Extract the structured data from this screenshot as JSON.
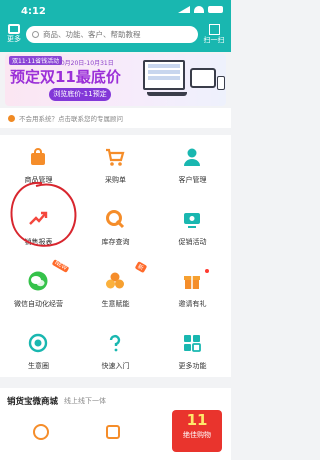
{
  "status_bar": {
    "time": "4:12"
  },
  "header": {
    "left_button": "更多",
    "search_placeholder": "商品、功能、客户、帮助教程",
    "scan_label": "扫一扫"
  },
  "banner": {
    "tag": "双11·11省钱活动",
    "date": "10月20日-10月31日",
    "headline": "预定双11最底价",
    "cta": "浏览底价-11预定"
  },
  "notice": {
    "text": "不会用系统？点击联系您的专属顾问"
  },
  "grid": [
    {
      "label": "商品管理",
      "icon": "bag-icon"
    },
    {
      "label": "采购单",
      "icon": "cart-icon"
    },
    {
      "label": "客户管理",
      "icon": "user-icon"
    },
    {
      "label": "销售报表",
      "icon": "trend-chart-icon"
    },
    {
      "label": "库存查询",
      "icon": "q-search-icon"
    },
    {
      "label": "促销活动",
      "icon": "promotion-icon"
    },
    {
      "label": "微信自动化经营",
      "icon": "wechat-icon",
      "badge": "NEW"
    },
    {
      "label": "生意赋能",
      "icon": "grow-icon",
      "badge": "新"
    },
    {
      "label": "邀请有礼",
      "icon": "gift-icon"
    },
    {
      "label": "生意圈",
      "icon": "circle-icon"
    },
    {
      "label": "快速入门",
      "icon": "question-icon"
    },
    {
      "label": "更多功能",
      "icon": "more-icon"
    }
  ],
  "mall": {
    "title": "销货宝微商城",
    "subtitle": "线上线下一体",
    "promo_number": "11",
    "promo_text": "绝佳购物"
  },
  "colors": {
    "primary": "#19b7b0",
    "orange": "#f58d2a",
    "promo_purple": "#8b3fc9"
  }
}
